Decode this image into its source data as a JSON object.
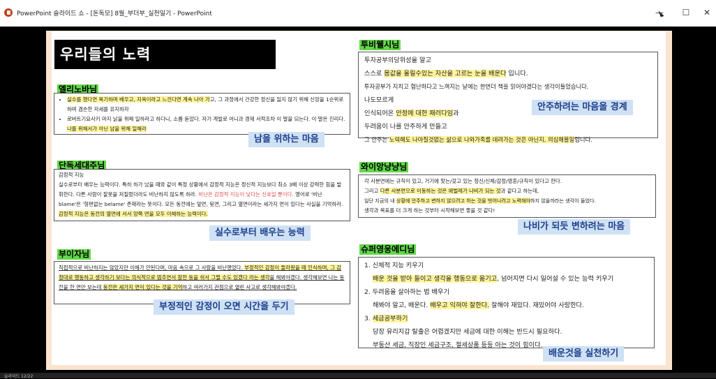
{
  "window": {
    "title": "PowerPoint 슬라이드 쇼 - [돈독모] 8월_부더부_실천일기 - PowerPoint",
    "minimize": "—",
    "maximize": "☐",
    "close": "✕"
  },
  "status": {
    "slide_label": "슬라이드 12/22"
  },
  "slide": {
    "title": "우리들의 노력",
    "sections": [
      {
        "name": "엘리노바님",
        "bullets": [
          {
            "pre": "",
            "hl": "실수를 했다면 복기하며 배우고, 지옥이라고 느낀다면 계속 나아 가",
            "post": "고, 그 과정에서 건강한 정신을 잃지 않기 위해 신앙을 1순위로 하며 겸손한 자세를 유지하자"
          },
          {
            "pre": "로버트기요사키 마지 낡을 위해 일하라고 하다니, 소름 돋았다. 자기 계발로 어니과 경제 서적조차 이 말을 되는다. 이 말은 진리다. ",
            "hl": "나를 위해서가 아닌 남을 위해 일해라",
            "post": ""
          }
        ],
        "badge": "남을 위하는 마음"
      },
      {
        "name": "단독세대주님",
        "lines": [
          {
            "pre": "감정적 지능",
            "hl": "",
            "post": ""
          },
          {
            "pre": "실수로부터 배우는 능력이다. 특히 하가 났을 때와 같이 특정 상황에서 감정적 지능은 정신적 지능보다 최소 3배 이상 강력한 힘을 발휘한다. 다른 사람이 잘못을 저질렀더라도 비난하지 않도록 하라. ",
            "red": "비난은 감정적 지능이 낮다는 신호일 뿐이다.",
            "post": " 영어로 '비난 blame'은 '형편없는 belame' 존재라는 뜻이다. 모든 동전에는 앞면, 뒷면, 그리고 옆면이라는 세가지 면이 있다는 사실을 기억하라. ",
            "hl": "감정적 지능은 동전의 옆면에 서서 양쪽 면을 모두 이해하는 능력이다."
          }
        ],
        "badge": "실수로부터 배우는 능력"
      },
      {
        "name": "부이자님",
        "text": {
          "pre": "직접적으로 비난하지는 않았지만 이해가 안된다며, 마음 속으로 그 사람을 비난했었다. ",
          "hl1": "부정적인 감정이 들라왔을 때 인식하며, 그 감정대로 행동하고 생각하기 보다는 의식적으로 멈추면서 잠한 동을 쉬서 그럴 수도 있겠다 라는 생각",
          "mid": "을 해봐야겠다. 생각해보면 나는 동전을 한 면만 보는데 ",
          "hl2": "동전은 세가지 면이 있다는 것을 기억",
          "post": "하고 여러가지 관점으로 열린 사고로 생각해봐야겠다."
        },
        "badge": "부정적인 감정이 오면 시간을 두기"
      },
      {
        "name": "투비웰시님",
        "lines": [
          {
            "pre": "투자공부의당위성을 알고",
            "hl": "",
            "post": ""
          },
          {
            "pre": "스스로 ",
            "hl": "몸값을 올릴수있는 자산을 고르는 눈을 배운다",
            "post": " 입니다."
          },
          {
            "pre": "투자공부가 지치고 험난하다고 느껴지는 날에는 한번더 책을 읽어야겠다는 생각이들었습니다.",
            "hl": "",
            "post": ""
          },
          {
            "pre": "나도모르게",
            "hl": "",
            "post": ""
          },
          {
            "pre": "인식되어온 ",
            "hl": "안정에 대한 패러다임",
            "post": "과"
          },
          {
            "pre": "두려움이 나를 안주하게 만들고",
            "hl": "",
            "post": ""
          },
          {
            "pre": "그 안주는 ",
            "hl": "노력해도 나아질것없는 삶으로 나와가족를 데려가는 것은 아닌지, 의심해볼일",
            "post": "입니다."
          }
        ],
        "badge": "안주하려는 마음을 경계"
      },
      {
        "name": "와이앙냥냥님",
        "lines": [
          {
            "pre": "각 사분면에는 규칙이 있고, 거기에 맞는/갖고 있는 정신/신체/감정/영혼/규칙이 있다고 한다.",
            "hl": "",
            "post": ""
          },
          {
            "pre": "그리고 ",
            "hl": "다른 사분면으로 이동하는 것은 애벌레가 나비가 되는 것",
            "post": "과 같다고 하는데,"
          },
          {
            "pre": "일단 지금의 내 ",
            "hl": "상황에 안주하고 변하지 않으려고 하는 것을 벗어나려고 노력해야",
            "post": "하지 않을까라는 생각이 들었다."
          },
          {
            "pre": "생각과 목표를 더 크게 하는 것부터 시작해보면 좋을 것 같다!",
            "hl": "",
            "post": ""
          }
        ],
        "badge": "나비가 되듯 변하려는 마음"
      },
      {
        "name": "슈퍼영웅에디님",
        "items": [
          {
            "num": "1.",
            "title": "신체적 지능 키우기",
            "sub": [
              {
                "pre": "",
                "hl": "배운 것을 받아 들이고 생각을 행동으로 옮기고",
                "post": ", 넘어지면 다시 일어설 수 있는 능력 키우기"
              }
            ]
          },
          {
            "num": "2.",
            "title": "두려움을 살아하는 법 배우기",
            "sub": [
              {
                "pre": "해봐야 알고, 배운다. ",
                "hl": "배우고 익혀야 잘한다.",
                "post": " 잘해야 재밌다. 재밌어야 사랑한다."
              }
            ]
          },
          {
            "num": "3.",
            "title": "세금공부하기",
            "title_hl": true,
            "sub": [
              {
                "pre": "당장 유리지갑 탈출은 어렵겠지만 세금에 대한 이해는 반드시 필요하다.",
                "hl": "",
                "post": ""
              },
              {
                "pre": "부동산 세금, 직장인 세금구조, 절세상품 등등 아는 것이 힘이다.",
                "hl": "",
                "post": ""
              }
            ]
          }
        ],
        "badge": "배운것을 실천하기"
      }
    ]
  }
}
